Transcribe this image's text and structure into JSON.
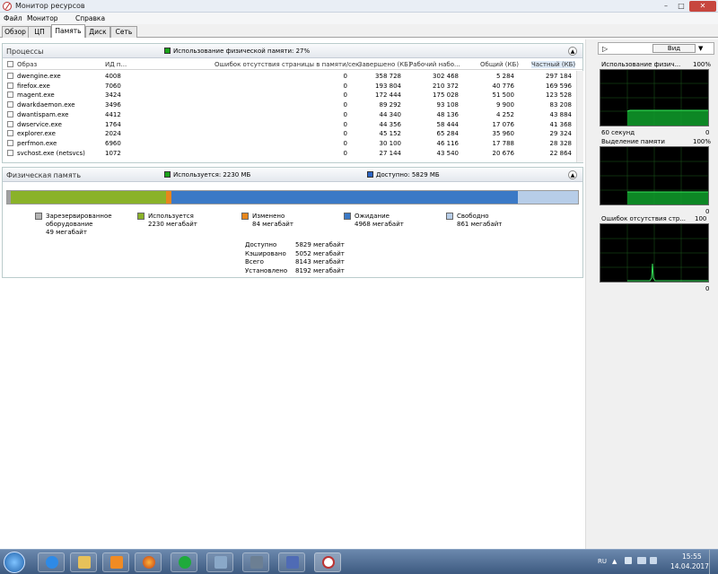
{
  "window": {
    "title": "Монитор ресурсов"
  },
  "menu": [
    "Файл",
    "Монитор",
    "Справка"
  ],
  "tabs": [
    "Обзор",
    "ЦП",
    "Память",
    "Диск",
    "Сеть"
  ],
  "processes": {
    "title": "Процессы",
    "legend": "Использование физической памяти: 27%",
    "columns": [
      "Образ",
      "ИД п...",
      "Ошибок отсутствия страницы в памяти/сек.",
      "Завершено (КБ)",
      "Рабочий набо...",
      "Общий (КБ)",
      "Частный (КБ)"
    ],
    "rows": [
      {
        "name": "dwengine.exe",
        "pid": "4008",
        "faults": "0",
        "commit": "358 728",
        "ws": "302 468",
        "shared": "5 284",
        "private": "297 184"
      },
      {
        "name": "firefox.exe",
        "pid": "7060",
        "faults": "0",
        "commit": "193 804",
        "ws": "210 372",
        "shared": "40 776",
        "private": "169 596"
      },
      {
        "name": "magent.exe",
        "pid": "3424",
        "faults": "0",
        "commit": "172 444",
        "ws": "175 028",
        "shared": "51 500",
        "private": "123 528"
      },
      {
        "name": "dwarkdaemon.exe",
        "pid": "3496",
        "faults": "0",
        "commit": "89 292",
        "ws": "93 108",
        "shared": "9 900",
        "private": "83 208"
      },
      {
        "name": "dwantispam.exe",
        "pid": "4412",
        "faults": "0",
        "commit": "44 340",
        "ws": "48 136",
        "shared": "4 252",
        "private": "43 884"
      },
      {
        "name": "dwservice.exe",
        "pid": "1764",
        "faults": "0",
        "commit": "44 356",
        "ws": "58 444",
        "shared": "17 076",
        "private": "41 368"
      },
      {
        "name": "explorer.exe",
        "pid": "2024",
        "faults": "0",
        "commit": "45 152",
        "ws": "65 284",
        "shared": "35 960",
        "private": "29 324"
      },
      {
        "name": "perfmon.exe",
        "pid": "6960",
        "faults": "0",
        "commit": "30 100",
        "ws": "46 116",
        "shared": "17 788",
        "private": "28 328"
      },
      {
        "name": "svchost.exe (netsvcs)",
        "pid": "1072",
        "faults": "0",
        "commit": "27 144",
        "ws": "43 540",
        "shared": "20 676",
        "private": "22 864"
      }
    ]
  },
  "physical": {
    "title": "Физическая память",
    "used_legend": "Используется: 2230 МБ",
    "avail_legend": "Доступно: 5829 МБ",
    "bar": [
      {
        "key": "reserved",
        "value": 49,
        "color": "#a0a0a0"
      },
      {
        "key": "used",
        "value": 2230,
        "color": "#8ab229"
      },
      {
        "key": "modified",
        "value": 84,
        "color": "#e8861b"
      },
      {
        "key": "standby",
        "value": 4968,
        "color": "#3b79c6"
      },
      {
        "key": "free",
        "value": 861,
        "color": "#b7cde8"
      }
    ],
    "legend_items": [
      {
        "label": "Зарезервированное оборудование",
        "value": "49 мегабайт",
        "color": "#b4b4b4"
      },
      {
        "label": "Используется",
        "value": "2230 мегабайт",
        "color": "#8ab229"
      },
      {
        "label": "Изменено",
        "value": "84 мегабайт",
        "color": "#e8861b"
      },
      {
        "label": "Ожидание",
        "value": "4968 мегабайт",
        "color": "#3b79c6"
      },
      {
        "label": "Свободно",
        "value": "861 мегабайт",
        "color": "#b7cde8"
      }
    ],
    "stats": [
      {
        "label": "Доступно",
        "value": "5829 мегабайт"
      },
      {
        "label": "Кэшировано",
        "value": "5052 мегабайт"
      },
      {
        "label": "Всего",
        "value": "8143 мегабайт"
      },
      {
        "label": "Установлено",
        "value": "8192 мегабайт"
      }
    ]
  },
  "right_panel": {
    "view_label": "Вид",
    "graphs": [
      {
        "title": "Использование физич...",
        "max": "100%",
        "min": "0",
        "xlabel": "60 секунд"
      },
      {
        "title": "Выделение памяти",
        "max": "100%",
        "min": "0",
        "xlabel": ""
      },
      {
        "title": "Ошибок отсутствия стр...",
        "max": "100",
        "min": "0",
        "xlabel": ""
      }
    ]
  },
  "taskbar": {
    "lang": "RU",
    "time": "15:55",
    "date": "14.04.2017"
  }
}
